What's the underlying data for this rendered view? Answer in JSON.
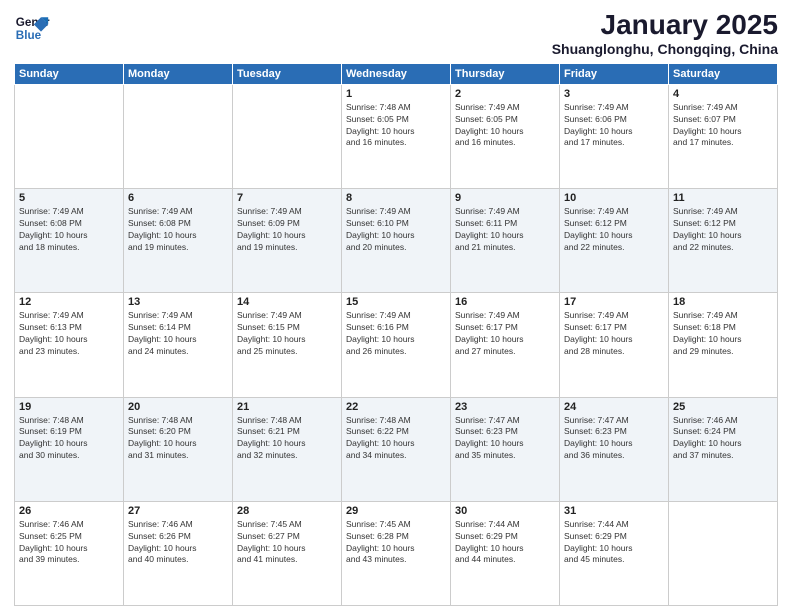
{
  "header": {
    "logo_line1": "General",
    "logo_line2": "Blue",
    "title": "January 2025",
    "subtitle": "Shuanglonghu, Chongqing, China"
  },
  "weekdays": [
    "Sunday",
    "Monday",
    "Tuesday",
    "Wednesday",
    "Thursday",
    "Friday",
    "Saturday"
  ],
  "weeks": [
    [
      {
        "day": "",
        "info": ""
      },
      {
        "day": "",
        "info": ""
      },
      {
        "day": "",
        "info": ""
      },
      {
        "day": "1",
        "info": "Sunrise: 7:48 AM\nSunset: 6:05 PM\nDaylight: 10 hours\nand 16 minutes."
      },
      {
        "day": "2",
        "info": "Sunrise: 7:49 AM\nSunset: 6:05 PM\nDaylight: 10 hours\nand 16 minutes."
      },
      {
        "day": "3",
        "info": "Sunrise: 7:49 AM\nSunset: 6:06 PM\nDaylight: 10 hours\nand 17 minutes."
      },
      {
        "day": "4",
        "info": "Sunrise: 7:49 AM\nSunset: 6:07 PM\nDaylight: 10 hours\nand 17 minutes."
      }
    ],
    [
      {
        "day": "5",
        "info": "Sunrise: 7:49 AM\nSunset: 6:08 PM\nDaylight: 10 hours\nand 18 minutes."
      },
      {
        "day": "6",
        "info": "Sunrise: 7:49 AM\nSunset: 6:08 PM\nDaylight: 10 hours\nand 19 minutes."
      },
      {
        "day": "7",
        "info": "Sunrise: 7:49 AM\nSunset: 6:09 PM\nDaylight: 10 hours\nand 19 minutes."
      },
      {
        "day": "8",
        "info": "Sunrise: 7:49 AM\nSunset: 6:10 PM\nDaylight: 10 hours\nand 20 minutes."
      },
      {
        "day": "9",
        "info": "Sunrise: 7:49 AM\nSunset: 6:11 PM\nDaylight: 10 hours\nand 21 minutes."
      },
      {
        "day": "10",
        "info": "Sunrise: 7:49 AM\nSunset: 6:12 PM\nDaylight: 10 hours\nand 22 minutes."
      },
      {
        "day": "11",
        "info": "Sunrise: 7:49 AM\nSunset: 6:12 PM\nDaylight: 10 hours\nand 22 minutes."
      }
    ],
    [
      {
        "day": "12",
        "info": "Sunrise: 7:49 AM\nSunset: 6:13 PM\nDaylight: 10 hours\nand 23 minutes."
      },
      {
        "day": "13",
        "info": "Sunrise: 7:49 AM\nSunset: 6:14 PM\nDaylight: 10 hours\nand 24 minutes."
      },
      {
        "day": "14",
        "info": "Sunrise: 7:49 AM\nSunset: 6:15 PM\nDaylight: 10 hours\nand 25 minutes."
      },
      {
        "day": "15",
        "info": "Sunrise: 7:49 AM\nSunset: 6:16 PM\nDaylight: 10 hours\nand 26 minutes."
      },
      {
        "day": "16",
        "info": "Sunrise: 7:49 AM\nSunset: 6:17 PM\nDaylight: 10 hours\nand 27 minutes."
      },
      {
        "day": "17",
        "info": "Sunrise: 7:49 AM\nSunset: 6:17 PM\nDaylight: 10 hours\nand 28 minutes."
      },
      {
        "day": "18",
        "info": "Sunrise: 7:49 AM\nSunset: 6:18 PM\nDaylight: 10 hours\nand 29 minutes."
      }
    ],
    [
      {
        "day": "19",
        "info": "Sunrise: 7:48 AM\nSunset: 6:19 PM\nDaylight: 10 hours\nand 30 minutes."
      },
      {
        "day": "20",
        "info": "Sunrise: 7:48 AM\nSunset: 6:20 PM\nDaylight: 10 hours\nand 31 minutes."
      },
      {
        "day": "21",
        "info": "Sunrise: 7:48 AM\nSunset: 6:21 PM\nDaylight: 10 hours\nand 32 minutes."
      },
      {
        "day": "22",
        "info": "Sunrise: 7:48 AM\nSunset: 6:22 PM\nDaylight: 10 hours\nand 34 minutes."
      },
      {
        "day": "23",
        "info": "Sunrise: 7:47 AM\nSunset: 6:23 PM\nDaylight: 10 hours\nand 35 minutes."
      },
      {
        "day": "24",
        "info": "Sunrise: 7:47 AM\nSunset: 6:23 PM\nDaylight: 10 hours\nand 36 minutes."
      },
      {
        "day": "25",
        "info": "Sunrise: 7:46 AM\nSunset: 6:24 PM\nDaylight: 10 hours\nand 37 minutes."
      }
    ],
    [
      {
        "day": "26",
        "info": "Sunrise: 7:46 AM\nSunset: 6:25 PM\nDaylight: 10 hours\nand 39 minutes."
      },
      {
        "day": "27",
        "info": "Sunrise: 7:46 AM\nSunset: 6:26 PM\nDaylight: 10 hours\nand 40 minutes."
      },
      {
        "day": "28",
        "info": "Sunrise: 7:45 AM\nSunset: 6:27 PM\nDaylight: 10 hours\nand 41 minutes."
      },
      {
        "day": "29",
        "info": "Sunrise: 7:45 AM\nSunset: 6:28 PM\nDaylight: 10 hours\nand 43 minutes."
      },
      {
        "day": "30",
        "info": "Sunrise: 7:44 AM\nSunset: 6:29 PM\nDaylight: 10 hours\nand 44 minutes."
      },
      {
        "day": "31",
        "info": "Sunrise: 7:44 AM\nSunset: 6:29 PM\nDaylight: 10 hours\nand 45 minutes."
      },
      {
        "day": "",
        "info": ""
      }
    ]
  ]
}
